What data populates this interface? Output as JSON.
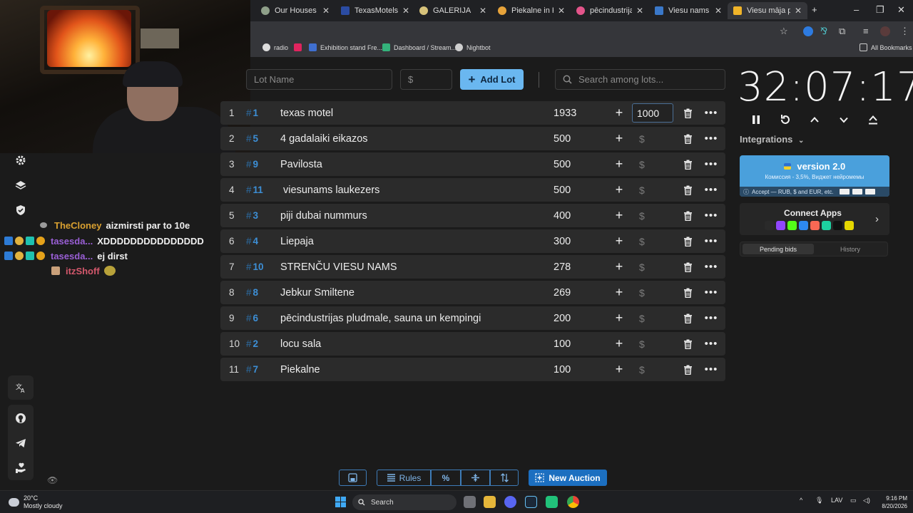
{
  "browser": {
    "tabs": [
      {
        "title": "Our Houses | View",
        "color": "#8fa08a"
      },
      {
        "title": "TexasMotels, Terre",
        "color": "#2b4ca3"
      },
      {
        "title": "GALERIJA",
        "color": "#d7c27a"
      },
      {
        "title": "Piekalne in Kalnie",
        "color": "#e7a33a"
      },
      {
        "title": "pēcindustrijas plu",
        "color": "#e3548a"
      },
      {
        "title": "Viesu nams Strenč",
        "color": "#3a78c9"
      },
      {
        "title": "Viesu māja pie ez",
        "color": "#f0b429"
      }
    ],
    "bookmarks": [
      {
        "label": "radio",
        "color": "#dddddd"
      },
      {
        "label": "",
        "color": "#e0245e"
      },
      {
        "label": "Exhibition stand Fre...",
        "color": "#3f6fd0"
      },
      {
        "label": "Dashboard / Stream...",
        "color": "#34b27b"
      },
      {
        "label": "Nightbot",
        "color": "#cfcfcf"
      }
    ],
    "all_bookmarks": "All Bookmarks"
  },
  "chat": [
    {
      "user": "TheCloney",
      "user_color": "#d9a030",
      "message": "aizmirsti par to 10e"
    },
    {
      "user": "tasesda...",
      "user_color": "#9a5fd6",
      "message": "XDDDDDDDDDDDDDDD"
    },
    {
      "user": "tasesda...",
      "user_color": "#9a5fd6",
      "message": "ej dirst"
    },
    {
      "user": "itzShoff",
      "user_color": "#d4586c",
      "message": ""
    }
  ],
  "form": {
    "lot_name_placeholder": "Lot Name",
    "amount_placeholder": "$",
    "add_lot_label": "Add Lot",
    "search_placeholder": "Search among lots..."
  },
  "lots": [
    {
      "rank": "1",
      "id": "1",
      "name": "texas motel",
      "amount": "1933",
      "bid": "1000"
    },
    {
      "rank": "2",
      "id": "5",
      "name": "4 gadalaiki eikazos",
      "amount": "500",
      "bid": "$"
    },
    {
      "rank": "3",
      "id": "9",
      "name": "Pavilosta",
      "amount": "500",
      "bid": "$"
    },
    {
      "rank": "4",
      "id": "11",
      "name": " viesunams laukezers",
      "amount": "500",
      "bid": "$"
    },
    {
      "rank": "5",
      "id": "3",
      "name": "piji dubai nummurs",
      "amount": "400",
      "bid": "$"
    },
    {
      "rank": "6",
      "id": "4",
      "name": "Liepaja",
      "amount": "300",
      "bid": "$"
    },
    {
      "rank": "7",
      "id": "10",
      "name": "STRENČU VIESU NAMS",
      "amount": "278",
      "bid": "$"
    },
    {
      "rank": "8",
      "id": "8",
      "name": "Jebkur Smiltene",
      "amount": "269",
      "bid": "$"
    },
    {
      "rank": "9",
      "id": "6",
      "name": "pēcindustrijas pludmale, sauna un kempingi",
      "amount": "200",
      "bid": "$"
    },
    {
      "rank": "10",
      "id": "2",
      "name": "locu sala",
      "amount": "100",
      "bid": "$"
    },
    {
      "rank": "11",
      "id": "7",
      "name": "Piekalne",
      "amount": "100",
      "bid": "$"
    }
  ],
  "timer": {
    "display": "32:07:17",
    "integrations_label": "Integrations"
  },
  "version_card": {
    "title": "version 2.0",
    "subtitle": "Комиссия - 3,5%, Виджет нейромемы",
    "footer": "Accept — RUB, $ and EUR, etc."
  },
  "connect_apps": {
    "title": "Connect Apps",
    "app_colors": [
      "#2a2a2a",
      "#9146ff",
      "#53fc18",
      "#2d89ef",
      "#f96854",
      "#1dd1a1",
      "#111111",
      "#e5d700"
    ]
  },
  "bids": {
    "pending_label": "Pending bids",
    "history_label": "History"
  },
  "toolbar": {
    "rules_label": "Rules",
    "new_auction_label": "New Auction"
  },
  "taskbar": {
    "temp": "20°C",
    "weather": "Mostly cloudy",
    "search": "Search",
    "lang": "LAV",
    "time": "9:16 PM",
    "date": "8/20/2026"
  },
  "colors": {
    "accent": "#6ab7f0",
    "lot_id": "#3d8fd6",
    "row_bg": "#2b2b2b"
  }
}
